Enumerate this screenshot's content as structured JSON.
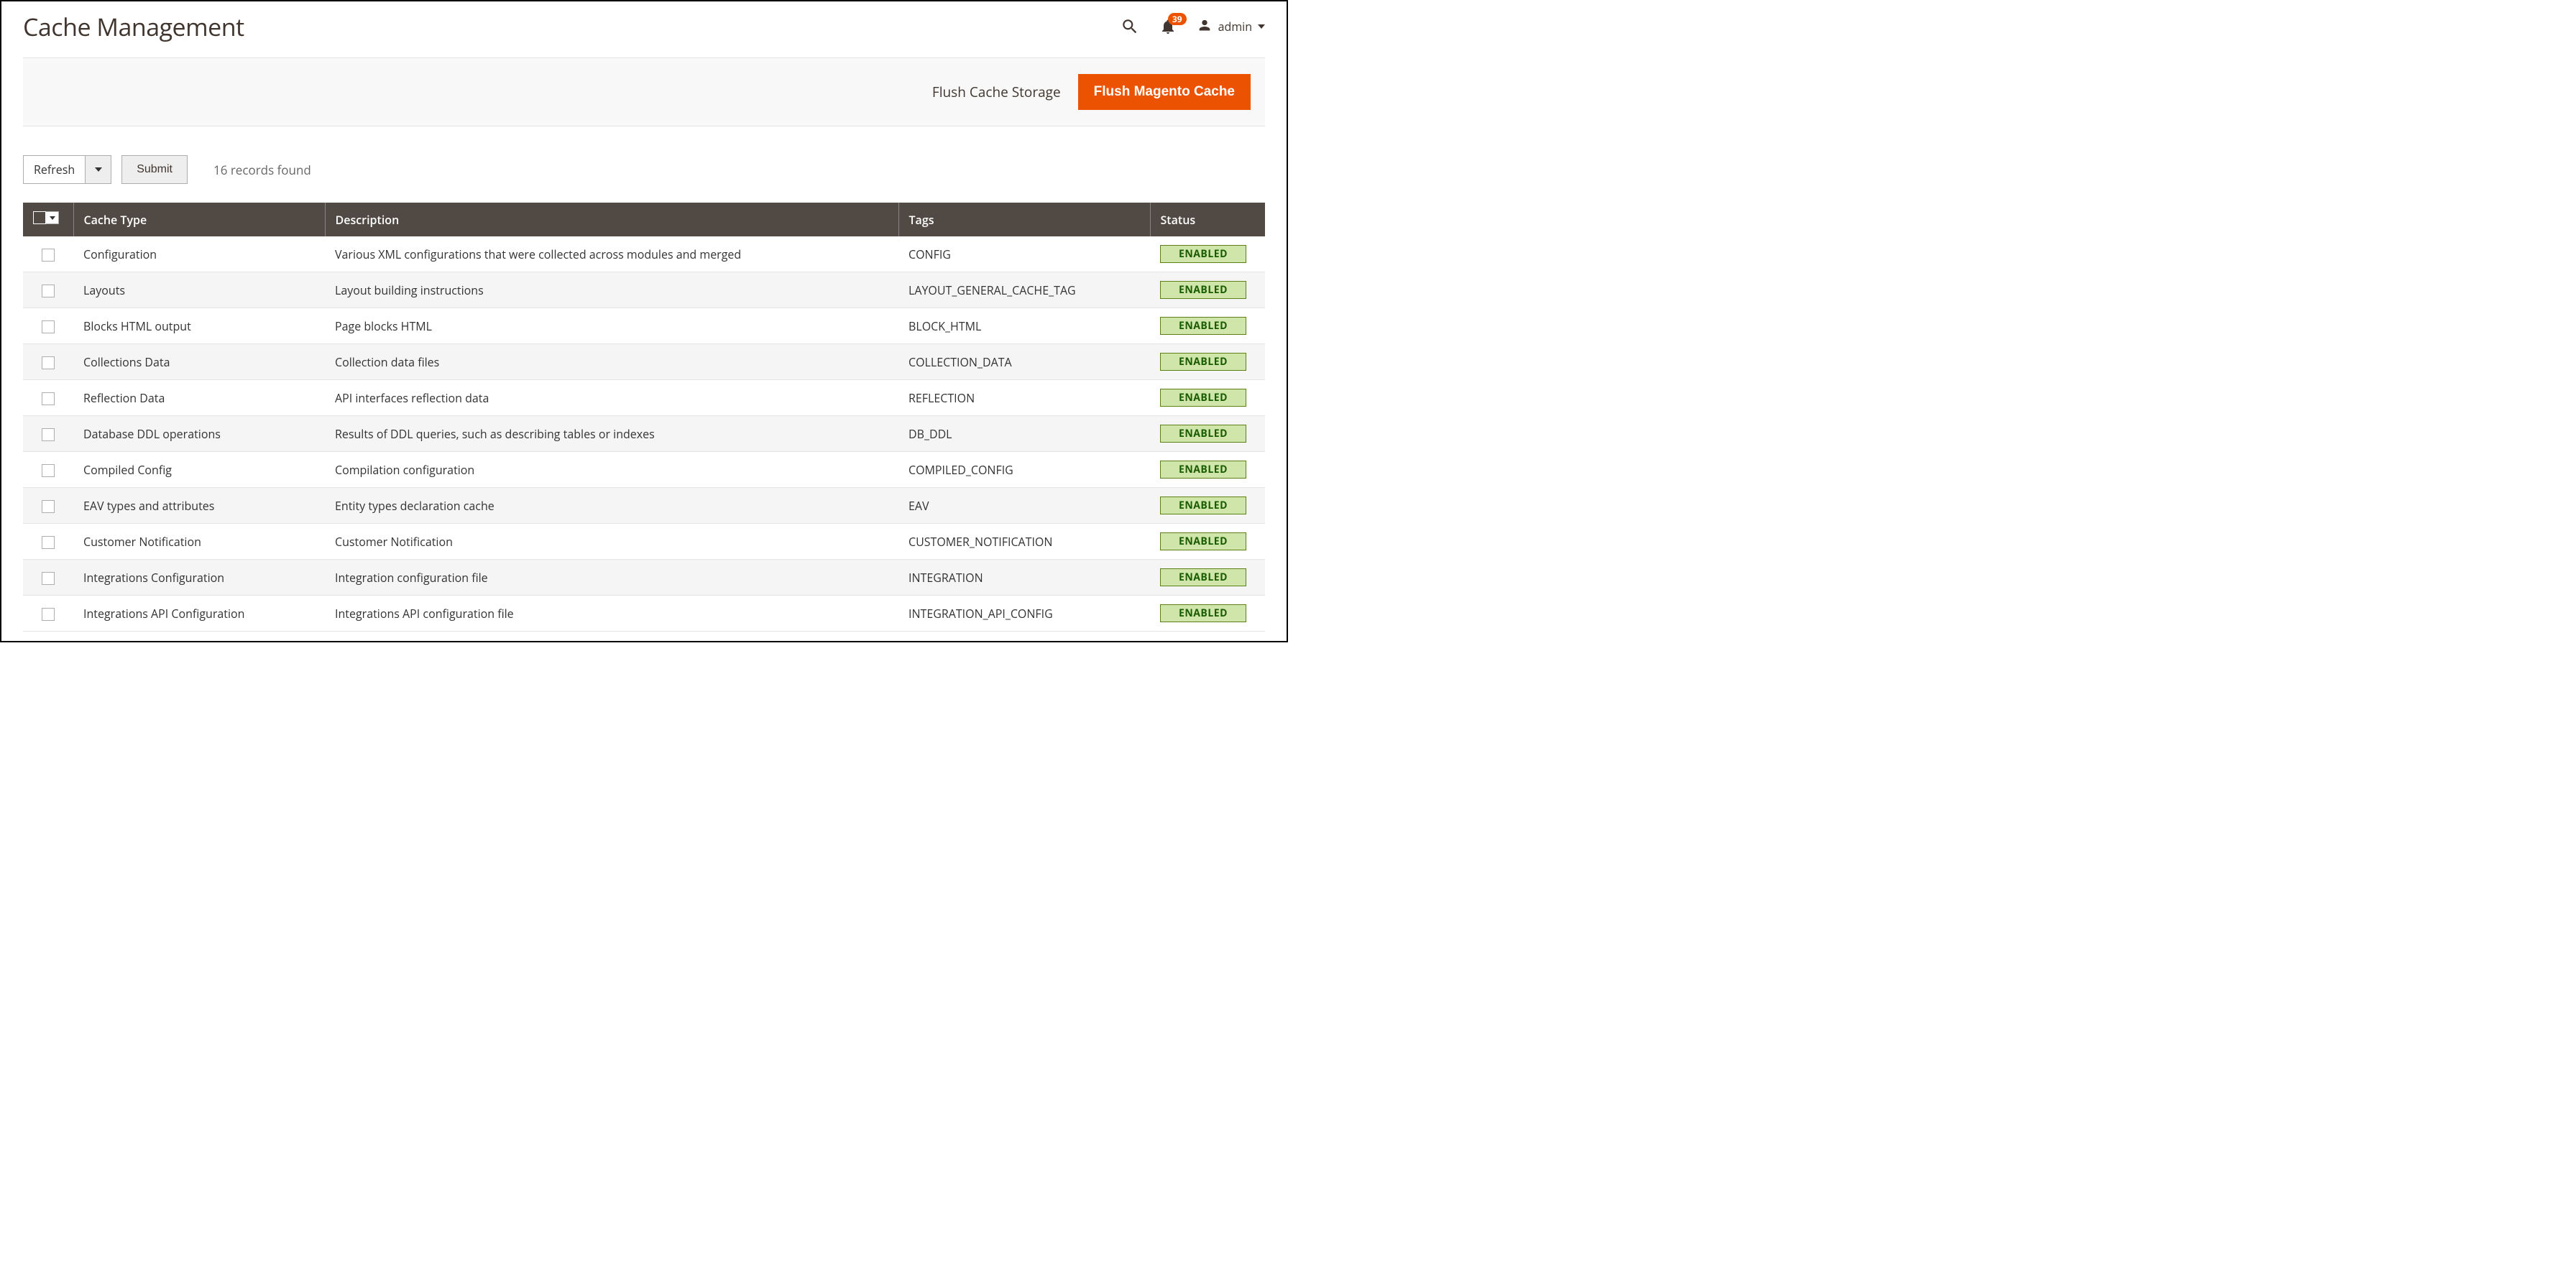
{
  "page": {
    "title": "Cache Management",
    "notification_count": "39",
    "user_name": "admin"
  },
  "actions": {
    "flush_storage": "Flush Cache Storage",
    "flush_magento": "Flush Magento Cache"
  },
  "controls": {
    "mass_action_value": "Refresh",
    "submit_label": "Submit",
    "records_found": "16 records found"
  },
  "columns": {
    "cache_type": "Cache Type",
    "description": "Description",
    "tags": "Tags",
    "status": "Status"
  },
  "status_enabled": "ENABLED",
  "rows": [
    {
      "type": "Configuration",
      "desc": "Various XML configurations that were collected across modules and merged",
      "tags": "CONFIG",
      "status": "ENABLED"
    },
    {
      "type": "Layouts",
      "desc": "Layout building instructions",
      "tags": "LAYOUT_GENERAL_CACHE_TAG",
      "status": "ENABLED"
    },
    {
      "type": "Blocks HTML output",
      "desc": "Page blocks HTML",
      "tags": "BLOCK_HTML",
      "status": "ENABLED"
    },
    {
      "type": "Collections Data",
      "desc": "Collection data files",
      "tags": "COLLECTION_DATA",
      "status": "ENABLED"
    },
    {
      "type": "Reflection Data",
      "desc": "API interfaces reflection data",
      "tags": "REFLECTION",
      "status": "ENABLED"
    },
    {
      "type": "Database DDL operations",
      "desc": "Results of DDL queries, such as describing tables or indexes",
      "tags": "DB_DDL",
      "status": "ENABLED"
    },
    {
      "type": "Compiled Config",
      "desc": "Compilation configuration",
      "tags": "COMPILED_CONFIG",
      "status": "ENABLED"
    },
    {
      "type": "EAV types and attributes",
      "desc": "Entity types declaration cache",
      "tags": "EAV",
      "status": "ENABLED"
    },
    {
      "type": "Customer Notification",
      "desc": "Customer Notification",
      "tags": "CUSTOMER_NOTIFICATION",
      "status": "ENABLED"
    },
    {
      "type": "Integrations Configuration",
      "desc": "Integration configuration file",
      "tags": "INTEGRATION",
      "status": "ENABLED"
    },
    {
      "type": "Integrations API Configuration",
      "desc": "Integrations API configuration file",
      "tags": "INTEGRATION_API_CONFIG",
      "status": "ENABLED"
    }
  ]
}
